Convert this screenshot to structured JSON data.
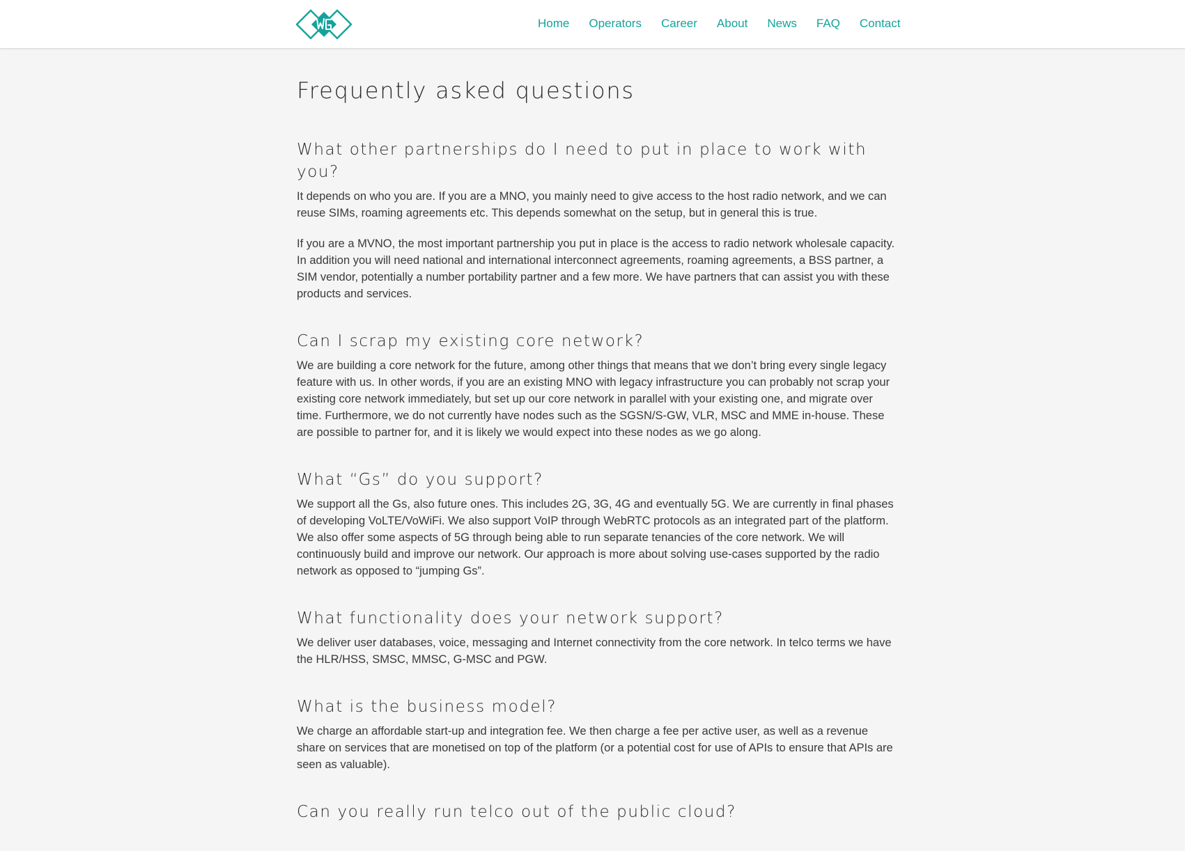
{
  "header": {
    "logo_text": "WG",
    "nav": [
      {
        "label": "Home"
      },
      {
        "label": "Operators"
      },
      {
        "label": "Career"
      },
      {
        "label": "About"
      },
      {
        "label": "News"
      },
      {
        "label": "FAQ"
      },
      {
        "label": "Contact"
      }
    ]
  },
  "main": {
    "title": "Frequently asked questions",
    "faqs": [
      {
        "question": "What other partnerships do I need to put in place to work with you?",
        "answers": [
          "It depends on who you are. If you are a MNO, you mainly need to give access to the host radio network, and we can reuse SIMs, roaming agreements etc. This depends somewhat on the setup, but in general this is true.",
          "If you are a MVNO, the most important partnership you put in place is the access to radio network wholesale capacity. In addition you will need national and international interconnect agreements, roaming agreements, a BSS partner, a SIM vendor, potentially a number portability partner and a few more. We have partners that can assist you with these products and services."
        ]
      },
      {
        "question": "Can I scrap my existing core network?",
        "answers": [
          "We are building a core network for the future, among other things that means that we don’t bring every single legacy feature with us. In other words, if you are an existing MNO with legacy infrastructure you can probably not scrap your existing core network immediately, but set up our core network in parallel with your existing one, and migrate over time. Furthermore, we do not currently have nodes such as the SGSN/S-GW, VLR, MSC and MME in-house. These are possible to partner for, and it is likely we would expect into these nodes as we go along."
        ]
      },
      {
        "question": "What “Gs” do you support?",
        "answers": [
          "We support all the Gs, also future ones. This includes 2G, 3G, 4G and eventually 5G. We are currently in final phases of developing VoLTE/VoWiFi. We also support VoIP through WebRTC protocols as an integrated part of the platform. We also offer some aspects of 5G through being able to run separate tenancies of the core network. We will continuously build and improve our network. Our approach is more about solving use-cases supported by the radio network as opposed to “jumping Gs”."
        ]
      },
      {
        "question": "What functionality does your network support?",
        "answers": [
          "We deliver user databases, voice, messaging and Internet connectivity from the core network. In telco terms we have the HLR/HSS, SMSC, MMSC, G-MSC and PGW."
        ]
      },
      {
        "question": "What is the business model?",
        "answers": [
          "We charge an affordable start-up and integration fee. We then charge a fee per active user, as well as a revenue share on services that are monetised on top of the platform (or a potential cost for use of APIs to ensure that APIs are seen as valuable)."
        ]
      },
      {
        "question": "Can you really run telco out of the public cloud?",
        "answers": []
      }
    ]
  },
  "colors": {
    "accent": "#14a39b",
    "background": "#f5f5f5",
    "header_bg": "#ffffff",
    "text": "#3a3a3a"
  },
  "icons": {
    "logo": "diamond-wg-logo-icon"
  }
}
